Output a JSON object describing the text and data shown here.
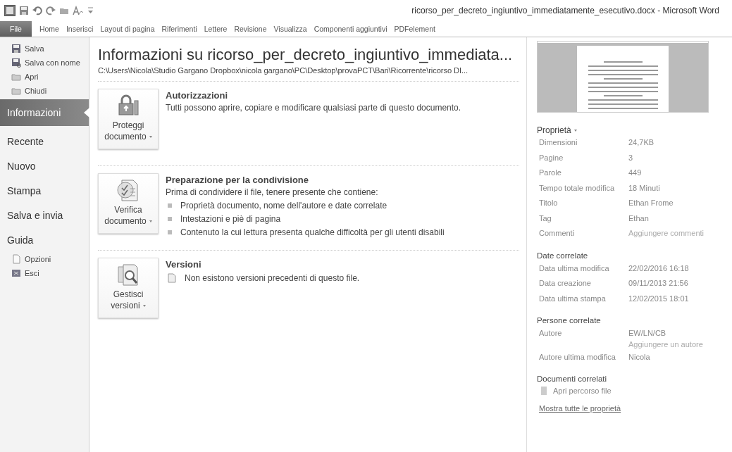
{
  "window": {
    "title": "ricorso_per_decreto_ingiuntivo_immediatamente_esecutivo.docx - Microsoft Word"
  },
  "ribbon_tabs": [
    {
      "label": "File",
      "selected": true
    },
    {
      "label": "Home",
      "selected": false
    },
    {
      "label": "Inserisci",
      "selected": false
    },
    {
      "label": "Layout di pagina",
      "selected": false
    },
    {
      "label": "Riferimenti",
      "selected": false
    },
    {
      "label": "Lettere",
      "selected": false
    },
    {
      "label": "Revisione",
      "selected": false
    },
    {
      "label": "Visualizza",
      "selected": false
    },
    {
      "label": "Componenti aggiuntivi",
      "selected": false
    },
    {
      "label": "PDFelement",
      "selected": false
    }
  ],
  "sidebar": {
    "items": [
      {
        "label": "Salva",
        "kind": "small",
        "selected": false
      },
      {
        "label": "Salva con nome",
        "kind": "small",
        "selected": false
      },
      {
        "label": "Apri",
        "kind": "small",
        "selected": false
      },
      {
        "label": "Chiudi",
        "kind": "small",
        "selected": false
      },
      {
        "label": "Informazioni",
        "kind": "large",
        "selected": true
      },
      {
        "label": "Recente",
        "kind": "large",
        "selected": false
      },
      {
        "label": "Nuovo",
        "kind": "large",
        "selected": false
      },
      {
        "label": "Stampa",
        "kind": "large",
        "selected": false
      },
      {
        "label": "Salva e invia",
        "kind": "large",
        "selected": false
      },
      {
        "label": "Guida",
        "kind": "large",
        "selected": false
      },
      {
        "label": "Opzioni",
        "kind": "small",
        "selected": false
      },
      {
        "label": "Esci",
        "kind": "small",
        "selected": false
      }
    ]
  },
  "info": {
    "title": "Informazioni su ricorso_per_decreto_ingiuntivo_immediata...",
    "path": "C:\\Users\\Nicola\\Studio Gargano Dropbox\\nicola gargano\\PC\\Desktop\\provaPCT\\Bari\\Ricorrente\\ricorso DI...",
    "sections": [
      {
        "button": "Proteggi documento",
        "heading": "Autorizzazioni",
        "description": "Tutti possono aprire, copiare e modificare qualsiasi parte di questo documento."
      },
      {
        "button": "Verifica documento",
        "heading": "Preparazione per la condivisione",
        "description": "Prima di condividere il file, tenere presente che contiene:",
        "bullets": [
          "Proprietà documento, nome dell'autore e date correlate",
          "Intestazioni e piè di pagina",
          "Contenuto la cui lettura presenta qualche difficoltà per gli utenti disabili"
        ]
      },
      {
        "button": "Gestisci versioni",
        "heading": "Versioni",
        "note": "Non esistono versioni precedenti di questo file."
      }
    ]
  },
  "properties": {
    "heading": "Proprietà",
    "groups": [
      {
        "rows": [
          {
            "label": "Dimensioni",
            "values": [
              {
                "text": "24,7KB",
                "kind": "value"
              }
            ]
          },
          {
            "label": "Pagine",
            "values": [
              {
                "text": "3",
                "kind": "value"
              }
            ]
          },
          {
            "label": "Parole",
            "values": [
              {
                "text": "449",
                "kind": "value"
              }
            ]
          },
          {
            "label": "Tempo totale modifica",
            "values": [
              {
                "text": "18 Minuti",
                "kind": "value"
              }
            ]
          },
          {
            "label": "Titolo",
            "values": [
              {
                "text": "Ethan Frome",
                "kind": "value"
              }
            ]
          },
          {
            "label": "Tag",
            "values": [
              {
                "text": "Ethan",
                "kind": "value"
              }
            ]
          },
          {
            "label": "Commenti",
            "values": [
              {
                "text": "Aggiungere commenti",
                "kind": "prompt"
              }
            ]
          }
        ]
      },
      {
        "title": "Date correlate",
        "rows": [
          {
            "label": "Data ultima modifica",
            "values": [
              {
                "text": "22/02/2016 16:18",
                "kind": "value"
              }
            ]
          },
          {
            "label": "Data creazione",
            "values": [
              {
                "text": "09/11/2013 21:56",
                "kind": "value"
              }
            ]
          },
          {
            "label": "Data ultima stampa",
            "values": [
              {
                "text": "12/02/2015 18:01",
                "kind": "value"
              }
            ]
          }
        ]
      },
      {
        "title": "Persone correlate",
        "rows": [
          {
            "label": "Autore",
            "values": [
              {
                "text": "EW/LN/CB",
                "kind": "value"
              },
              {
                "text": "Aggiungere un autore",
                "kind": "prompt"
              }
            ]
          },
          {
            "label": "Autore ultima modifica",
            "values": [
              {
                "text": "Nicola",
                "kind": "value"
              }
            ]
          }
        ]
      }
    ],
    "related_docs": {
      "title": "Documenti correlati",
      "link": "Apri percorso file"
    },
    "show_all": "Mostra tutte le proprietà"
  }
}
